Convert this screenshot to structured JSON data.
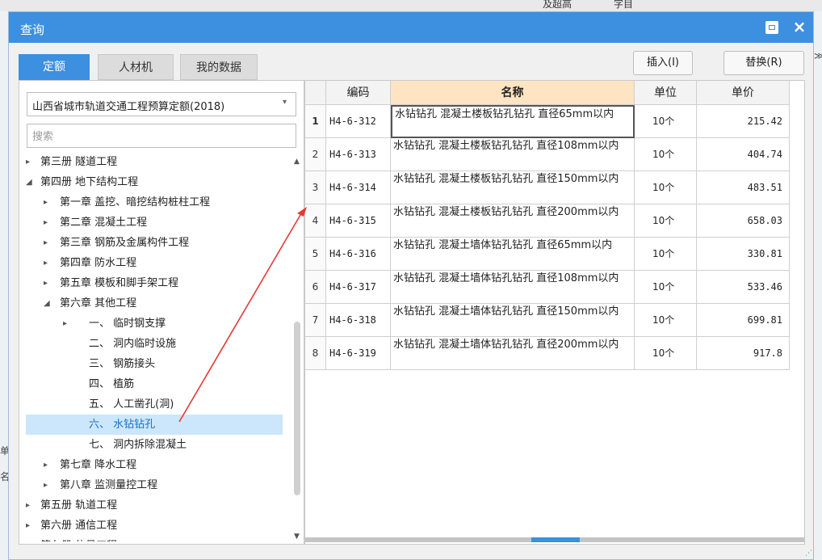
{
  "background": {
    "top_items": [
      "及超高",
      "字目"
    ],
    "right_mark": "≫",
    "left_marks": [
      "单",
      "名"
    ]
  },
  "dialog": {
    "title": "查询",
    "maximize_icon": "maximize-icon",
    "close_symbol": "×",
    "accent_color": "#3d8fe0"
  },
  "tabs": [
    {
      "label": "定额",
      "active": true
    },
    {
      "label": "人材机",
      "active": false
    },
    {
      "label": "我的数据",
      "active": false
    }
  ],
  "buttons": {
    "insert": "插入(I)",
    "replace": "替换(R)"
  },
  "left": {
    "quota_select": "山西省城市轨道交通工程预算定额(2018)",
    "search_placeholder": "搜索",
    "tree": [
      {
        "label": "第三册 隧道工程",
        "arrow": "▸",
        "level": 0,
        "selected": false
      },
      {
        "label": "第四册 地下结构工程",
        "arrow": "◢",
        "level": 0,
        "selected": false
      },
      {
        "label": "第一章 盖挖、暗挖结构桩柱工程",
        "arrow": "▸",
        "level": 1,
        "selected": false
      },
      {
        "label": "第二章 混凝土工程",
        "arrow": "▸",
        "level": 1,
        "selected": false
      },
      {
        "label": "第三章 钢筋及金属构件工程",
        "arrow": "▸",
        "level": 1,
        "selected": false
      },
      {
        "label": "第四章 防水工程",
        "arrow": "▸",
        "level": 1,
        "selected": false
      },
      {
        "label": "第五章 模板和脚手架工程",
        "arrow": "▸",
        "level": 1,
        "selected": false
      },
      {
        "label": "第六章 其他工程",
        "arrow": "◢",
        "level": 1,
        "selected": false
      },
      {
        "label": "一、 临时钢支撑",
        "arrow": "▸",
        "level": 2,
        "selected": false
      },
      {
        "label": "二、 洞内临时设施",
        "arrow": "",
        "level": 2,
        "selected": false
      },
      {
        "label": "三、 钢筋接头",
        "arrow": "",
        "level": 2,
        "selected": false
      },
      {
        "label": "四、 植筋",
        "arrow": "",
        "level": 2,
        "selected": false
      },
      {
        "label": "五、 人工凿孔(洞)",
        "arrow": "",
        "level": 2,
        "selected": false
      },
      {
        "label": "六、 水钻钻孔",
        "arrow": "",
        "level": 2,
        "selected": true
      },
      {
        "label": "七、 洞内拆除混凝土",
        "arrow": "",
        "level": 2,
        "selected": false
      },
      {
        "label": "第七章 降水工程",
        "arrow": "▸",
        "level": 1,
        "selected": false
      },
      {
        "label": "第八章 监测量控工程",
        "arrow": "▸",
        "level": 1,
        "selected": false
      },
      {
        "label": "第五册 轨道工程",
        "arrow": "▸",
        "level": 0,
        "selected": false
      },
      {
        "label": "第六册 通信工程",
        "arrow": "▸",
        "level": 0,
        "selected": false
      },
      {
        "label": "第七册 信号工程",
        "arrow": "▸",
        "level": 0,
        "selected": false
      }
    ]
  },
  "table": {
    "columns": {
      "code": "编码",
      "name": "名称",
      "unit": "单位",
      "price": "单价"
    },
    "rows": [
      {
        "num": "1",
        "code": "H4-6-312",
        "name": "水钻钻孔 混凝土楼板钻孔钻孔 直径65mm以内",
        "unit": "10个",
        "price": "215.42"
      },
      {
        "num": "2",
        "code": "H4-6-313",
        "name": "水钻钻孔 混凝土楼板钻孔钻孔 直径108mm以内",
        "unit": "10个",
        "price": "404.74"
      },
      {
        "num": "3",
        "code": "H4-6-314",
        "name": "水钻钻孔 混凝土楼板钻孔钻孔 直径150mm以内",
        "unit": "10个",
        "price": "483.51"
      },
      {
        "num": "4",
        "code": "H4-6-315",
        "name": "水钻钻孔 混凝土楼板钻孔钻孔 直径200mm以内",
        "unit": "10个",
        "price": "658.03"
      },
      {
        "num": "5",
        "code": "H4-6-316",
        "name": "水钻钻孔 混凝土墙体钻孔钻孔 直径65mm以内",
        "unit": "10个",
        "price": "330.81"
      },
      {
        "num": "6",
        "code": "H4-6-317",
        "name": "水钻钻孔 混凝土墙体钻孔钻孔 直径108mm以内",
        "unit": "10个",
        "price": "533.46"
      },
      {
        "num": "7",
        "code": "H4-6-318",
        "name": "水钻钻孔 混凝土墙体钻孔钻孔 直径150mm以内",
        "unit": "10个",
        "price": "699.81"
      },
      {
        "num": "8",
        "code": "H4-6-319",
        "name": "水钻钻孔 混凝土墙体钻孔钻孔 直径200mm以内",
        "unit": "10个",
        "price": "917.8"
      }
    ]
  },
  "annotation": {
    "color": "#e53935"
  }
}
